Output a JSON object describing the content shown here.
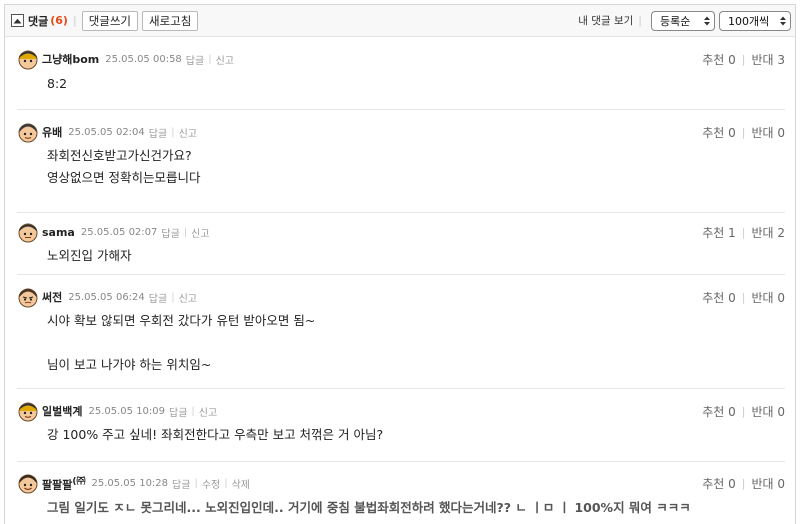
{
  "toolbar": {
    "title": "댓글",
    "count": "(6)",
    "write_label": "댓글쓰기",
    "refresh_label": "새로고침",
    "my_comments_label": "내 댓글 보기",
    "sort_value": "등록순",
    "per_page_value": "100개씩"
  },
  "comments": [
    {
      "author": "그냥해bom",
      "date": "25.05.05 00:58",
      "action1": "답글",
      "action2": "신고",
      "recommend": "추천 0",
      "oppose": "반대 3",
      "lines": [
        "8:2"
      ]
    },
    {
      "author": "유배",
      "date": "25.05.05 02:04",
      "action1": "답글",
      "action2": "신고",
      "recommend": "추천 0",
      "oppose": "반대 0",
      "lines": [
        "좌회전신호받고가신건가요?",
        "영상없으면 정확히는모릅니다"
      ]
    },
    {
      "author": "sama",
      "date": "25.05.05 02:07",
      "action1": "답글",
      "action2": "신고",
      "recommend": "추천 1",
      "oppose": "반대 2",
      "lines": [
        "노외진입 가해자"
      ]
    },
    {
      "author": "써전",
      "date": "25.05.05 06:24",
      "action1": "답글",
      "action2": "신고",
      "recommend": "추천 0",
      "oppose": "반대 0",
      "lines": [
        "시야 확보 않되면 우회전 갔다가 유턴 받아오면 됨~",
        "",
        "님이 보고 나가야 하는 위치임~"
      ]
    },
    {
      "author": "일벌백계",
      "date": "25.05.05 10:09",
      "action1": "답글",
      "action2": "신고",
      "recommend": "추천 0",
      "oppose": "반대 0",
      "lines": [
        "강 100% 주고 싶네! 좌회전한다고 우측만 보고 처꺾은 거 아님?"
      ]
    },
    {
      "author": "팔팔팔",
      "author_badge": "(㈜",
      "date": "25.05.05 10:28",
      "action1": "답글",
      "action2": "수정",
      "action3": "삭제",
      "recommend": "추천 0",
      "oppose": "반대 0",
      "lines": [
        "그림 일기도 ㅈㄴ 못그리네... 노외진입인데.. 거기에 중침 불법좌회전하려 했다는거네?? ㄴ ㅣㅁ ㅣ 100%지 뭐여 ㅋㅋㅋ"
      ]
    }
  ]
}
